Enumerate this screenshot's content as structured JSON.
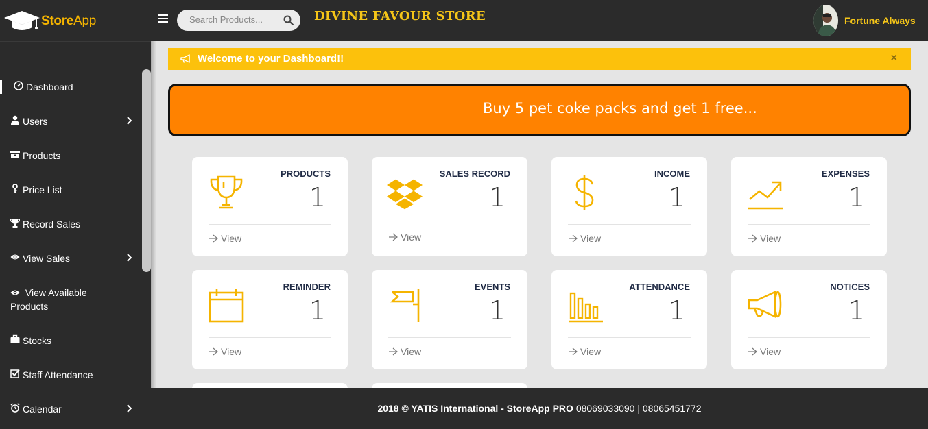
{
  "brand": {
    "name_bold": "Store",
    "name_light": "App"
  },
  "search": {
    "placeholder": "Search Products..."
  },
  "store_title": "DIVINE FAVOUR STORE",
  "user": {
    "name": "Fortune Always"
  },
  "sidebar": {
    "items": [
      {
        "label": "Dashboard",
        "icon": "dashboard-icon",
        "has_submenu": false
      },
      {
        "label": "Users",
        "icon": "user-icon",
        "has_submenu": true
      },
      {
        "label": "Products",
        "icon": "archive-icon",
        "has_submenu": false
      },
      {
        "label": "Price List",
        "icon": "key-icon",
        "has_submenu": false
      },
      {
        "label": "Record Sales",
        "icon": "trophy-icon",
        "has_submenu": false
      },
      {
        "label": "View Sales",
        "icon": "eye-icon",
        "has_submenu": true
      },
      {
        "label": "View Available Products",
        "icon": "eye-icon",
        "has_submenu": false
      },
      {
        "label": "Stocks",
        "icon": "briefcase-icon",
        "has_submenu": false
      },
      {
        "label": "Staff Attendance",
        "icon": "checkbox-icon",
        "has_submenu": false
      },
      {
        "label": "Calendar",
        "icon": "alarm-icon",
        "has_submenu": true
      }
    ]
  },
  "welcome": {
    "text": "Welcome to your Dashboard!!",
    "close": "×"
  },
  "promo": {
    "text": "Buy 5 pet coke packs and get 1 free..."
  },
  "cards": [
    {
      "title": "PRODUCTS",
      "value": "1",
      "link": "View",
      "icon": "trophy-icon"
    },
    {
      "title": "SALES RECORD",
      "value": "1",
      "link": "View",
      "icon": "dropbox-icon"
    },
    {
      "title": "INCOME",
      "value": "1",
      "link": "View",
      "icon": "dollar-icon"
    },
    {
      "title": "EXPENSES",
      "value": "1",
      "link": "View",
      "icon": "trend-up-icon"
    },
    {
      "title": "REMINDER",
      "value": "1",
      "link": "View",
      "icon": "calendar-icon"
    },
    {
      "title": "EVENTS",
      "value": "1",
      "link": "View",
      "icon": "flag-icon"
    },
    {
      "title": "ATTENDANCE",
      "value": "1",
      "link": "View",
      "icon": "bar-chart-icon"
    },
    {
      "title": "NOTICES",
      "value": "1",
      "link": "View",
      "icon": "megaphone-icon"
    }
  ],
  "footer": {
    "copyright": "2018 © YATIS International - StoreApp PRO",
    "phones": "08069033090 | 08065451772"
  },
  "colors": {
    "accent": "#f5b400",
    "welcome_bg": "#fcc10c",
    "promo_bg": "#ff8200",
    "dark": "#2b2b2b"
  }
}
